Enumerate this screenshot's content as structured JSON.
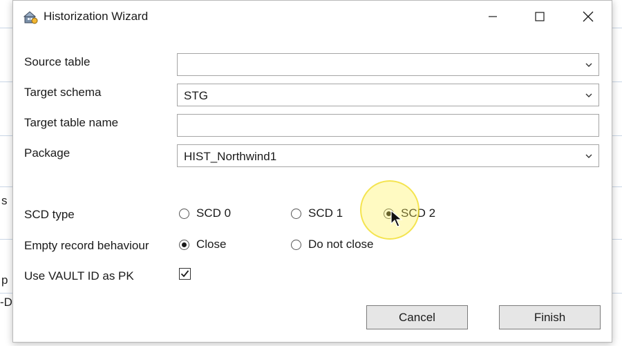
{
  "window": {
    "title": "Historization Wizard",
    "minimize_label": "Minimize",
    "maximize_label": "Maximize",
    "close_label": "Close"
  },
  "form": {
    "source_table": {
      "label": "Source table",
      "value": ""
    },
    "target_schema": {
      "label": "Target schema",
      "value": "STG"
    },
    "target_table_name": {
      "label": "Target table name",
      "value": ""
    },
    "package": {
      "label": "Package",
      "value": "HIST_Northwind1"
    },
    "scd_type": {
      "label": "SCD type",
      "options": [
        "SCD 0",
        "SCD 1",
        "SCD 2"
      ],
      "selected": "SCD 2"
    },
    "empty_record_behaviour": {
      "label": "Empty record behaviour",
      "options": [
        "Close",
        "Do not close"
      ],
      "selected": "Close"
    },
    "use_vault_id_as_pk": {
      "label": "Use VAULT ID as PK",
      "checked": true
    }
  },
  "buttons": {
    "cancel": "Cancel",
    "finish": "Finish"
  },
  "background": {
    "fragment_1": "s",
    "fragment_2": "p",
    "fragment_3": "-D"
  }
}
